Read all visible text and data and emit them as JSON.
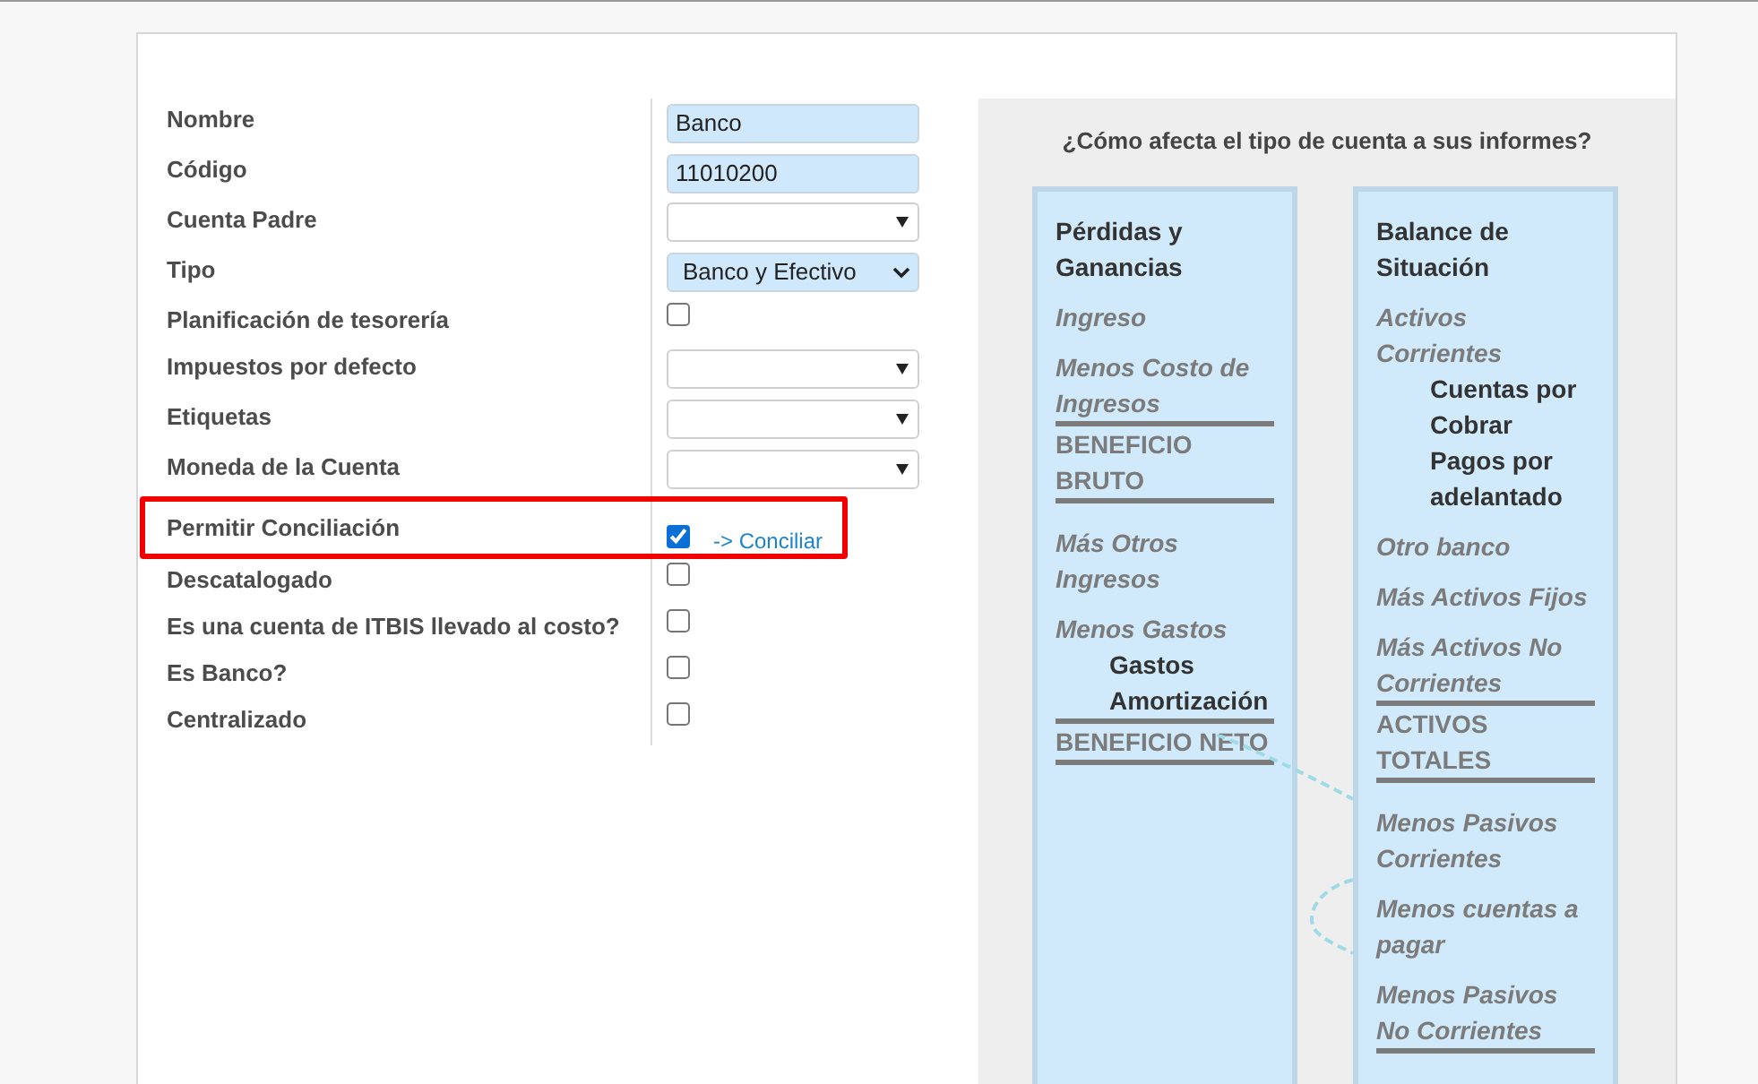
{
  "form": {
    "fields": [
      {
        "label": "Nombre",
        "kind": "text",
        "value": "Banco"
      },
      {
        "label": "Código",
        "kind": "text",
        "value": "11010200"
      },
      {
        "label": "Cuenta Padre",
        "kind": "many2one"
      },
      {
        "label": "Tipo",
        "kind": "select",
        "value": "Banco y Efectivo"
      },
      {
        "label": "Planificación de tesorería",
        "kind": "checkbox",
        "checked": false
      },
      {
        "label": "Impuestos por defecto",
        "kind": "many2one"
      },
      {
        "label": "Etiquetas",
        "kind": "many2one"
      },
      {
        "label": "Moneda de la Cuenta",
        "kind": "many2one"
      },
      {
        "label": "Permitir Conciliación",
        "kind": "checkbox",
        "checked": true,
        "highlighted": true,
        "link": "-> Conciliar"
      },
      {
        "label": "Descatalogado",
        "kind": "checkbox",
        "checked": false
      },
      {
        "label": "Es una cuenta de ITBIS llevado al costo?",
        "kind": "checkbox",
        "checked": false
      },
      {
        "label": "Es Banco?",
        "kind": "checkbox",
        "checked": false
      },
      {
        "label": "Centralizado",
        "kind": "checkbox",
        "checked": false
      }
    ]
  },
  "help_panel": {
    "title": "¿Cómo afecta el tipo de cuenta a sus informes?",
    "columns": [
      {
        "items": [
          {
            "kind": "heading",
            "text": "Pérdidas y Ganancias"
          },
          {
            "kind": "line",
            "text": "Ingreso"
          },
          {
            "kind": "line",
            "text": "Menos Costo de Ingresos"
          },
          {
            "kind": "total",
            "text": "BENEFICIO BRUTO"
          },
          {
            "kind": "line",
            "text": "Más Otros Ingresos"
          },
          {
            "kind": "line",
            "text": "Menos Gastos",
            "children": [
              {
                "text": "Gastos"
              },
              {
                "text": "Amortización"
              }
            ]
          },
          {
            "kind": "total",
            "text": "BENEFICIO NETO"
          }
        ]
      },
      {
        "items": [
          {
            "kind": "heading",
            "text": "Balance de Situación"
          },
          {
            "kind": "line",
            "text": "Activos Corrientes",
            "children": [
              {
                "text": "Cuentas por Cobrar"
              },
              {
                "text": "Pagos por adelantado"
              }
            ]
          },
          {
            "kind": "line",
            "text": "Otro banco"
          },
          {
            "kind": "line",
            "text": "Más Activos Fijos"
          },
          {
            "kind": "line",
            "text": "Más Activos No Corrientes"
          },
          {
            "kind": "total",
            "text": "ACTIVOS TOTALES"
          },
          {
            "kind": "line",
            "text": "Menos Pasivos Corrientes"
          },
          {
            "kind": "line",
            "text": "Menos cuentas a pagar"
          },
          {
            "kind": "line",
            "text": "Menos Pasivos No Corrientes",
            "underline": true
          }
        ]
      }
    ]
  }
}
